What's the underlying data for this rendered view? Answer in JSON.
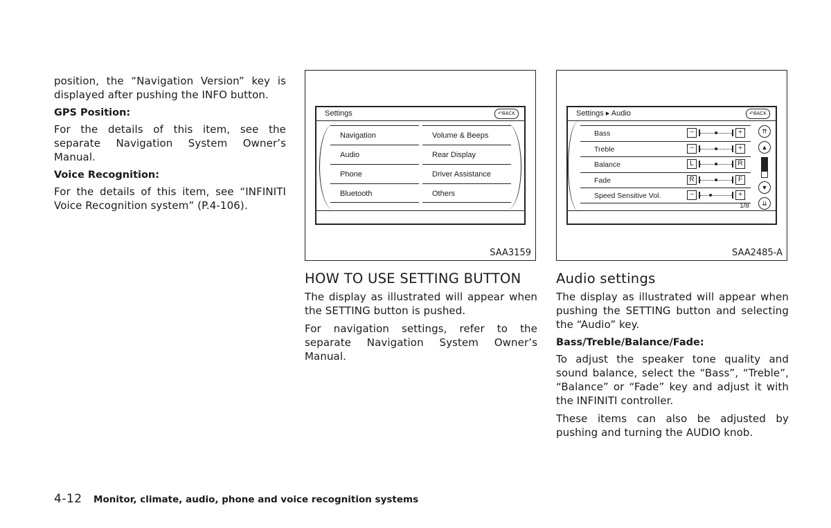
{
  "left_column": {
    "intro": "position, the “Navigation Version” key is displayed after pushing the INFO button.",
    "gps_heading": "GPS Position:",
    "gps_text": "For the details of this item, see the separate Navigation System Owner’s Manual.",
    "voice_heading": "Voice Recognition:",
    "voice_text": "For the details of this item, see “INFINITI Voice Recognition system” (P.4-106)."
  },
  "figure_settings": {
    "code": "SAA3159",
    "screen_title": "Settings",
    "back_label": "BACK",
    "left_items": [
      "Navigation",
      "Audio",
      "Phone",
      "Bluetooth"
    ],
    "right_items": [
      "Volume & Beeps",
      "Rear Display",
      "Driver Assistance",
      "Others"
    ]
  },
  "figure_audio": {
    "code": "SAA2485-A",
    "screen_title": "Settings ▸ Audio",
    "back_label": "BACK",
    "rows": [
      {
        "label": "Bass",
        "left_btn": "−",
        "right_btn": "+",
        "level": 0.5
      },
      {
        "label": "Treble",
        "left_btn": "−",
        "right_btn": "+",
        "level": 0.5
      },
      {
        "label": "Balance",
        "left_btn": "L",
        "right_btn": "R",
        "level": 0.5
      },
      {
        "label": "Fade",
        "left_btn": "R",
        "right_btn": "F",
        "level": 0.5
      },
      {
        "label": "Speed Sensitive Vol.",
        "left_btn": "−",
        "right_btn": "+",
        "level": 0.3
      }
    ],
    "page_indicator": "1/8",
    "scroll_fraction": 0.7
  },
  "mid_column": {
    "heading": "HOW TO USE SETTING BUTTON",
    "p1": "The display as illustrated will appear when the SETTING button is pushed.",
    "p2": "For navigation settings, refer to the separate Navigation System Owner’s Manual."
  },
  "right_column": {
    "heading": "Audio settings",
    "p1": "The display as illustrated will appear when pushing the SETTING button and selecting the “Audio” key.",
    "sub_heading": "Bass/Treble/Balance/Fade:",
    "p2": "To adjust the speaker tone quality and sound balance, select the “Bass”, “Treble”, “Balance” or “Fade” key and adjust it with the INFINITI controller.",
    "p3": "These items can also be adjusted by pushing and turning the AUDIO knob."
  },
  "footer": {
    "page_number": "4-12",
    "section_title": "Monitor, climate, audio, phone and voice recognition systems"
  }
}
